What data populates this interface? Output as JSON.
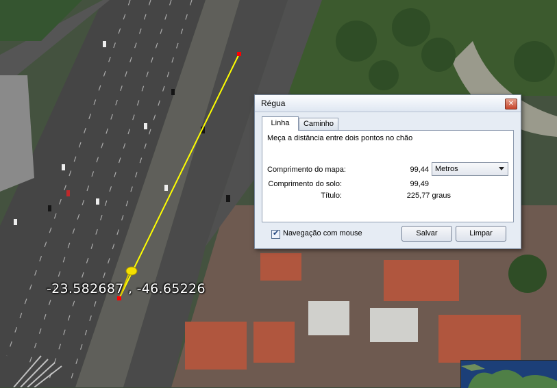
{
  "map": {
    "coordinates": "-23.582687 , -46.65226",
    "colors": {
      "route_line": "#ffff00",
      "route_endpoint": "#ff0000",
      "placemark": "#f5e000"
    },
    "icons": [
      "placemark-pushpin-icon"
    ]
  },
  "dialog": {
    "title": "Régua",
    "close_glyph": "✕",
    "tabs": [
      {
        "label": "Linha",
        "active": true
      },
      {
        "label": "Caminho",
        "active": false
      }
    ],
    "description": "Meça a distância entre dois pontos no chão",
    "map_length": {
      "label": "Comprimento do mapa:",
      "value": "99,44"
    },
    "unit_select": {
      "value": "Metros"
    },
    "ground_length": {
      "label": "Comprimento do solo:",
      "value": "99,49"
    },
    "heading": {
      "label": "Título:",
      "value": "225,77 graus"
    },
    "mouse_navigation": {
      "label": "Navegação com mouse",
      "checked": true
    },
    "save_label": "Salvar",
    "clear_label": "Limpar"
  }
}
